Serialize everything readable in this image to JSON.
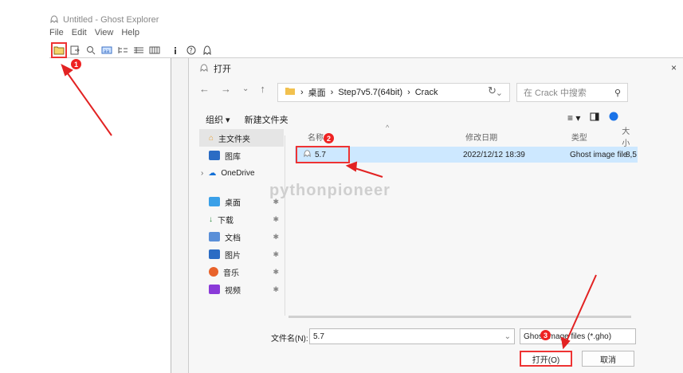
{
  "app": {
    "title": "Untitled - Ghost Explorer",
    "menu": [
      "File",
      "Edit",
      "View",
      "Help"
    ]
  },
  "dialog": {
    "title": "打开",
    "close": "×",
    "breadcrumb": [
      "桌面",
      "Step7v5.7(64bit)",
      "Crack"
    ],
    "search_placeholder": "在 Crack 中搜索",
    "organize": "组织 ▾",
    "new_folder": "新建文件夹",
    "nav_items": [
      {
        "label": "主文件夹",
        "icon": "home-icon",
        "color": "#e8a33a",
        "pinned": false
      },
      {
        "label": "图库",
        "icon": "gallery-icon",
        "color": "#2b6cc4",
        "pinned": false
      },
      {
        "label": "OneDrive",
        "icon": "cloud-icon",
        "color": "#1470d6",
        "pinned": false
      },
      {
        "label": "桌面",
        "icon": "desktop-icon",
        "color": "#3aa0e8",
        "pinned": true
      },
      {
        "label": "下载",
        "icon": "download-icon",
        "color": "#2b8a3e",
        "pinned": true
      },
      {
        "label": "文档",
        "icon": "document-icon",
        "color": "#5a8fd8",
        "pinned": true
      },
      {
        "label": "图片",
        "icon": "picture-icon",
        "color": "#2b6cc4",
        "pinned": true
      },
      {
        "label": "音乐",
        "icon": "music-icon",
        "color": "#e8622a",
        "pinned": true
      },
      {
        "label": "视频",
        "icon": "video-icon",
        "color": "#8a3ad8",
        "pinned": true
      }
    ],
    "columns": {
      "name": "名称",
      "date": "修改日期",
      "type": "类型",
      "size": "大小"
    },
    "files": [
      {
        "name": "5.7",
        "date": "2022/12/12 18:39",
        "type": "Ghost image file",
        "size": "8,5"
      }
    ],
    "filename_label": "文件名(N):",
    "filename_value": "5.7",
    "filter_value": "Ghost image files (*.gho)",
    "open_button": "打开(O)",
    "cancel_button": "取消"
  },
  "watermark": "pythonpioneer",
  "annotations": {
    "step1": "1",
    "step2": "2",
    "step3": "3",
    "color": "#e22222"
  }
}
